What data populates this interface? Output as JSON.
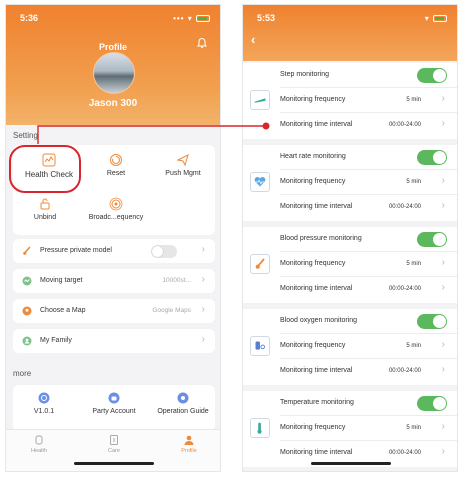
{
  "left": {
    "status_time": "5:36",
    "header_title": "Profile",
    "username": "Jason 300",
    "settings_label": "Setting",
    "grid": [
      {
        "label": "Health Check"
      },
      {
        "label": "Reset"
      },
      {
        "label": "Push Mgmt"
      },
      {
        "label": "Unbind"
      },
      {
        "label": "Broadc...equency"
      }
    ],
    "rows": [
      {
        "label": "Pressure private model",
        "value": ""
      },
      {
        "label": "Moving target",
        "value": "10000st..."
      },
      {
        "label": "Choose a Map",
        "value": "Google Maps"
      },
      {
        "label": "My Family",
        "value": ""
      }
    ],
    "more_label": "more",
    "more_items": [
      {
        "label": "V1.0.1"
      },
      {
        "label": "Party Account"
      },
      {
        "label": "Operation Guide"
      }
    ],
    "tabs": [
      {
        "label": "Health"
      },
      {
        "label": "Care"
      },
      {
        "label": "Profile"
      }
    ]
  },
  "right": {
    "status_time": "5:53",
    "sections": [
      {
        "title": "Step monitoring",
        "freq_label": "Monitoring frequency",
        "freq_value": "5 min",
        "interval_label": "Monitoring time interval",
        "interval_value": "00:00-24:00"
      },
      {
        "title": "Heart rate monitoring",
        "freq_label": "Monitoring frequency",
        "freq_value": "5 min",
        "interval_label": "Monitoring time interval",
        "interval_value": "00:00-24:00"
      },
      {
        "title": "Blood pressure monitoring",
        "freq_label": "Monitoring frequency",
        "freq_value": "5 min",
        "interval_label": "Monitoring time interval",
        "interval_value": "00:00-24:00"
      },
      {
        "title": "Blood oxygen monitoring",
        "freq_label": "Monitoring frequency",
        "freq_value": "5 min",
        "interval_label": "Monitoring time interval",
        "interval_value": "00:00-24:00"
      },
      {
        "title": "Temperature monitoring",
        "freq_label": "Monitoring frequency",
        "freq_value": "5 min",
        "interval_label": "Monitoring time interval",
        "interval_value": "00:00-24:00"
      }
    ]
  },
  "colors": {
    "accent": "#f0812f",
    "toggle_on": "#5cb85c",
    "highlight": "#d8262c"
  }
}
